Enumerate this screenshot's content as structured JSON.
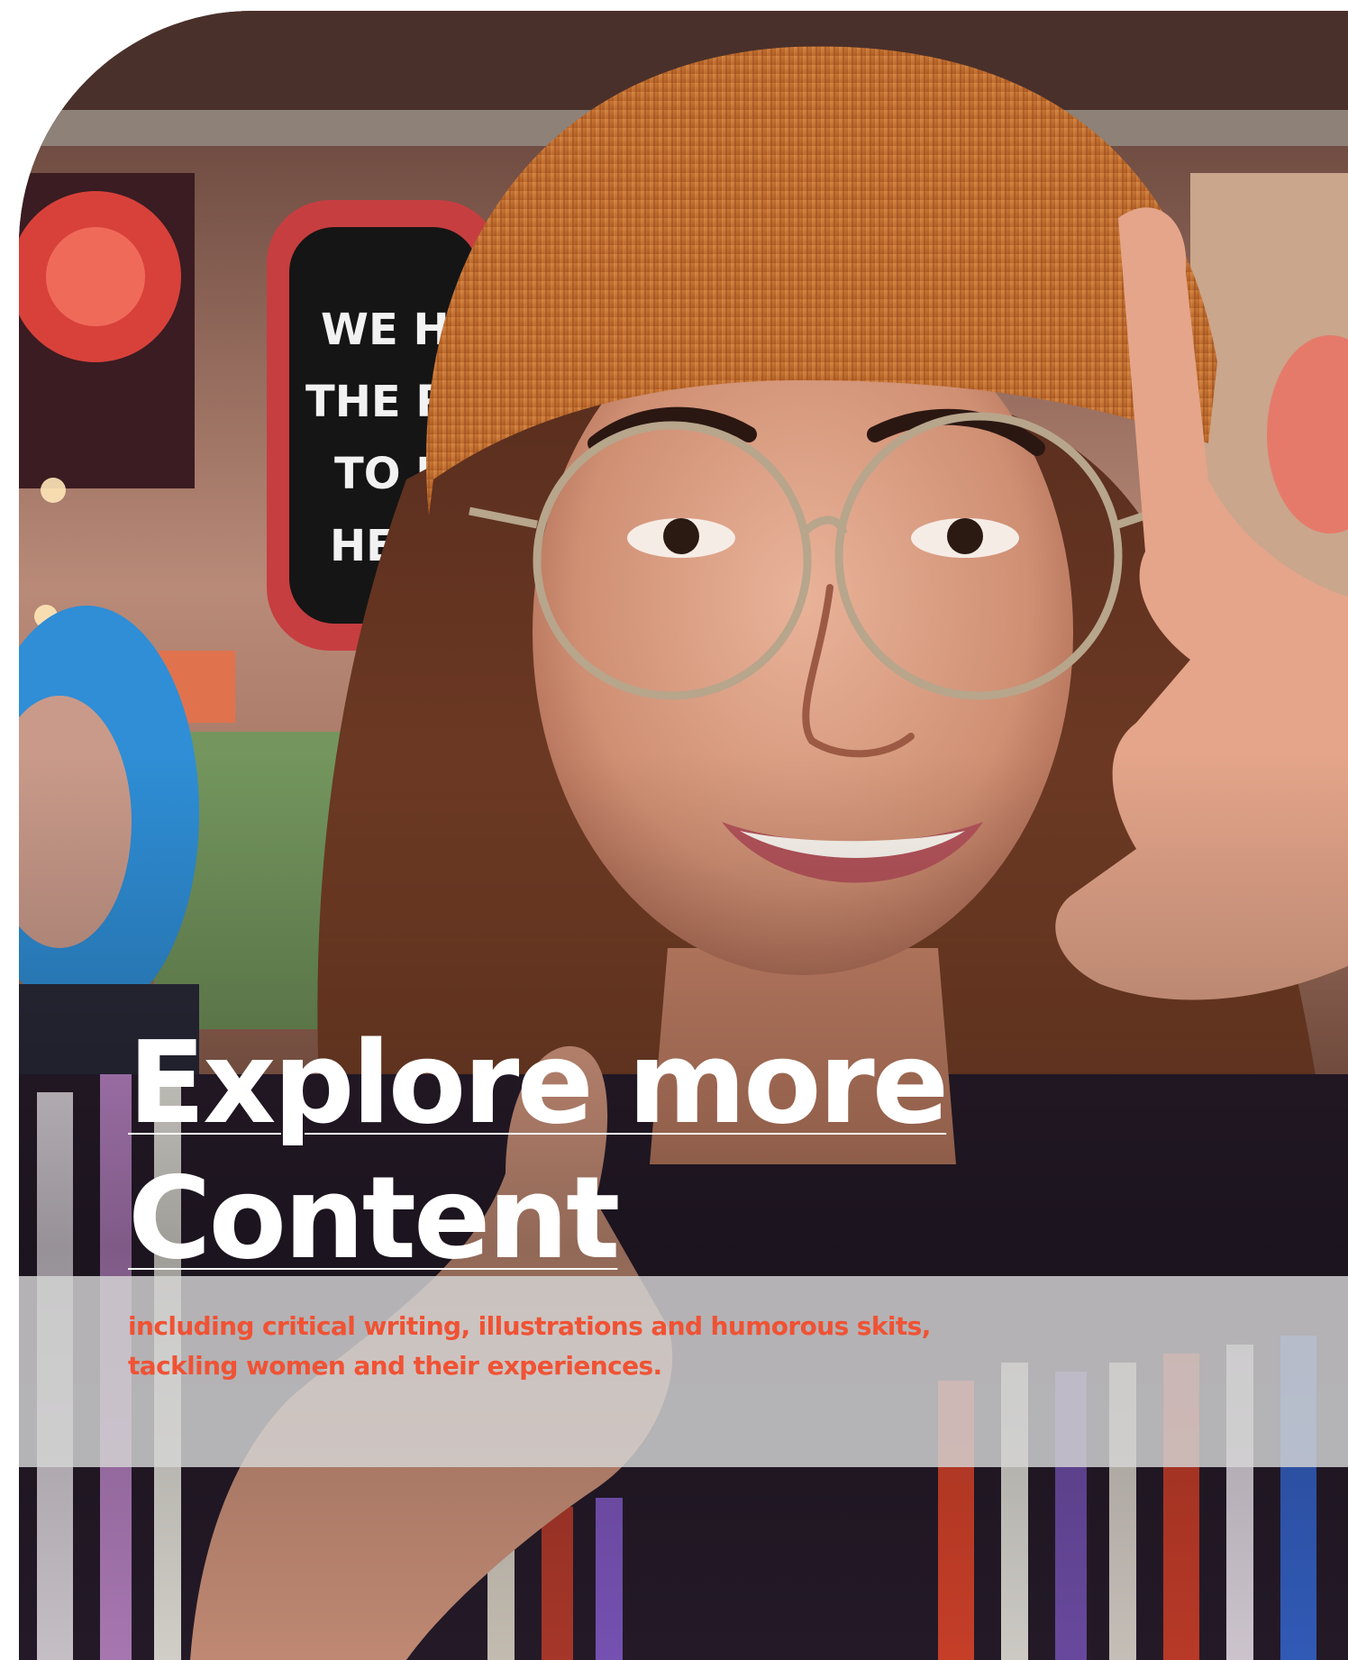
{
  "hero": {
    "headline_line1": "Explore more",
    "headline_line2": "Content",
    "subtitle": "including critical writing, illustrations and humorous skits, tackling women and their experiences."
  },
  "background": {
    "poster_text": [
      "WE HA",
      "THE RI",
      "TO I",
      "HEA"
    ]
  },
  "colors": {
    "headline": "#ffffff",
    "subtitle": "#f05234",
    "band": "#d6d6d6",
    "beanie": "#c46a2e"
  }
}
